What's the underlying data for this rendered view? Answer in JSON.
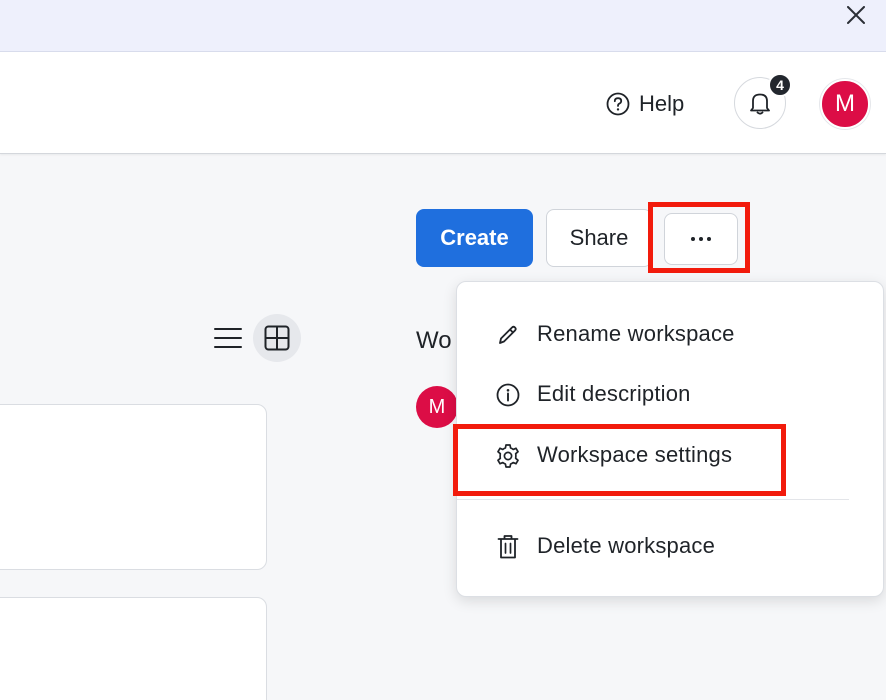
{
  "header": {
    "help_label": "Help",
    "notification_count": "4",
    "avatar_initial": "M"
  },
  "toolbar": {
    "create_label": "Create",
    "share_label": "Share",
    "more_label": "···"
  },
  "side_panel": {
    "heading": "Wo",
    "member_initial": "M"
  },
  "menu": {
    "items": [
      {
        "label": "Rename workspace",
        "icon": "pencil-icon"
      },
      {
        "label": "Edit description",
        "icon": "info-icon"
      },
      {
        "label": "Workspace settings",
        "icon": "gear-icon"
      },
      {
        "label": "Delete workspace",
        "icon": "trash-icon"
      }
    ]
  },
  "colors": {
    "accent": "#1f6fde",
    "avatar": "#dc0d46",
    "highlight": "#f21b0c",
    "banner": "#eef0fc"
  },
  "icons": {
    "banner_close": "close-icon",
    "help": "help-circle-icon",
    "notifications": "bell-icon",
    "view_list": "list-view-icon",
    "view_grid": "grid-view-icon"
  }
}
